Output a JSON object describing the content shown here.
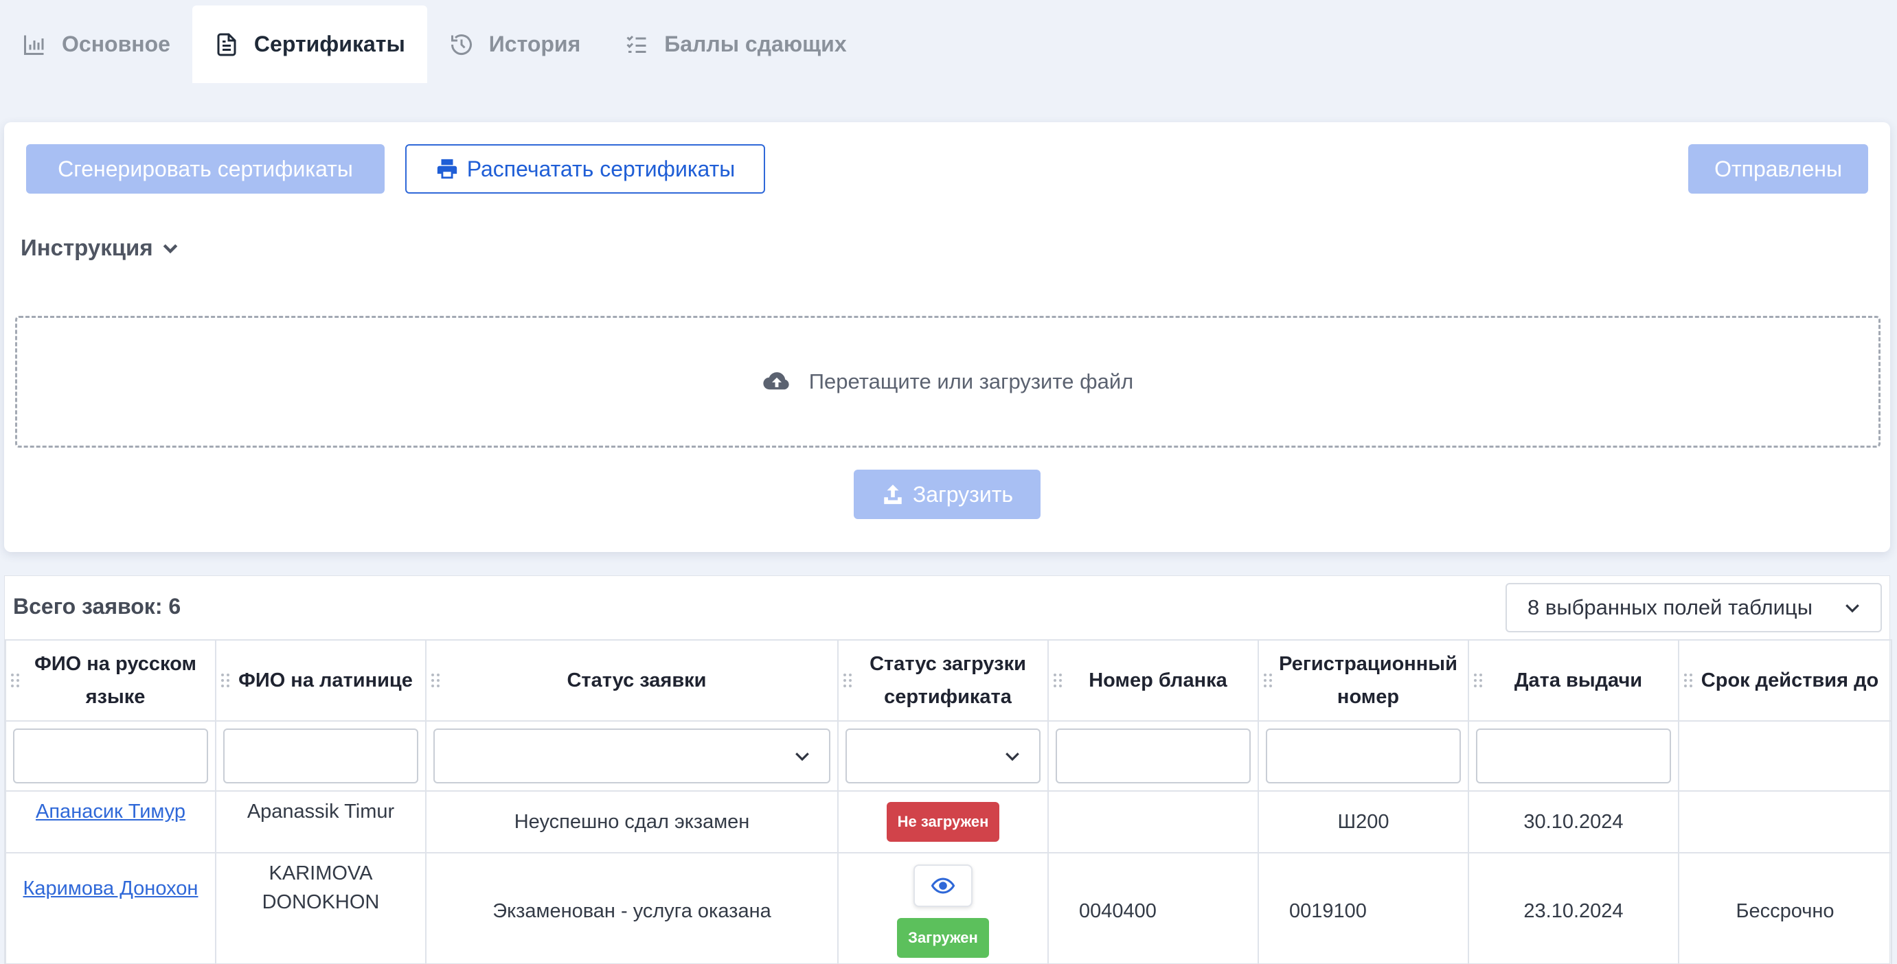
{
  "tabs": [
    {
      "label": "Основное",
      "icon": "bar-chart-icon",
      "active": false
    },
    {
      "label": "Сертификаты",
      "icon": "document-icon",
      "active": true
    },
    {
      "label": "История",
      "icon": "history-icon",
      "active": false
    },
    {
      "label": "Баллы сдающих",
      "icon": "checklist-icon",
      "active": false
    }
  ],
  "toolbar": {
    "generate_label": "Сгенерировать сертификаты",
    "print_label": "Распечатать сертификаты",
    "sent_label": "Отправлены"
  },
  "instruction_label": "Инструкция",
  "dropzone_text": "Перетащите или загрузите файл",
  "upload_label": "Загрузить",
  "table": {
    "total_label": "Всего заявок: 6",
    "fields_select_label": "8 выбранных полей таблицы",
    "headers": [
      "ФИО на русском языке",
      "ФИО на латинице",
      "Статус заявки",
      "Статус загрузки сертификата",
      "Номер бланка",
      "Регистрационный номер",
      "Дата выдачи",
      "Срок действия до"
    ],
    "rows": [
      {
        "name_ru": "Апанасик Тимур ",
        "name_lat": "Apanassik Timur",
        "status": "Неуспешно сдал экзамен",
        "cert_status": "Не загружен",
        "blank_no": "",
        "reg_no": "Ш200",
        "issue_date": "30.10.2024",
        "valid_until": ""
      },
      {
        "name_ru": "Каримова Донохон ",
        "name_lat": "KARIMOVA DONOKHON",
        "status": "Экзаменован - услуга оказана",
        "cert_status": "Загружен",
        "blank_no": "0040400",
        "reg_no": "0019100",
        "issue_date": "23.10.2024",
        "valid_until": "Бессрочно"
      }
    ]
  },
  "colors": {
    "accent": "#2f68d8",
    "disabled_button": "#a8bff3",
    "badge_red": "#d1434a",
    "badge_green": "#5cc05c",
    "page_bg": "#eef2f9"
  }
}
